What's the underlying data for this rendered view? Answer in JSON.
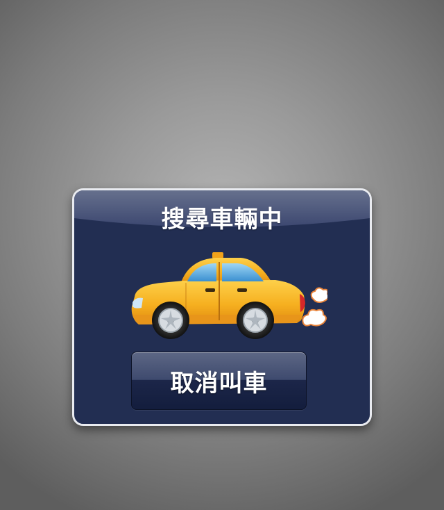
{
  "dialog": {
    "title": "搜尋車輛中",
    "cancel_label": "取消叫車",
    "illustration_icon": "taxi-icon",
    "exhaust_icon": "exhaust-puff-icon"
  },
  "colors": {
    "background": "#9a9a9a",
    "dialog_fill": "#222e52",
    "dialog_border": "#e9ebf0",
    "taxi_yellow": "#f5b31e",
    "button_top": "#5d6785",
    "button_bottom": "#131d3d"
  }
}
